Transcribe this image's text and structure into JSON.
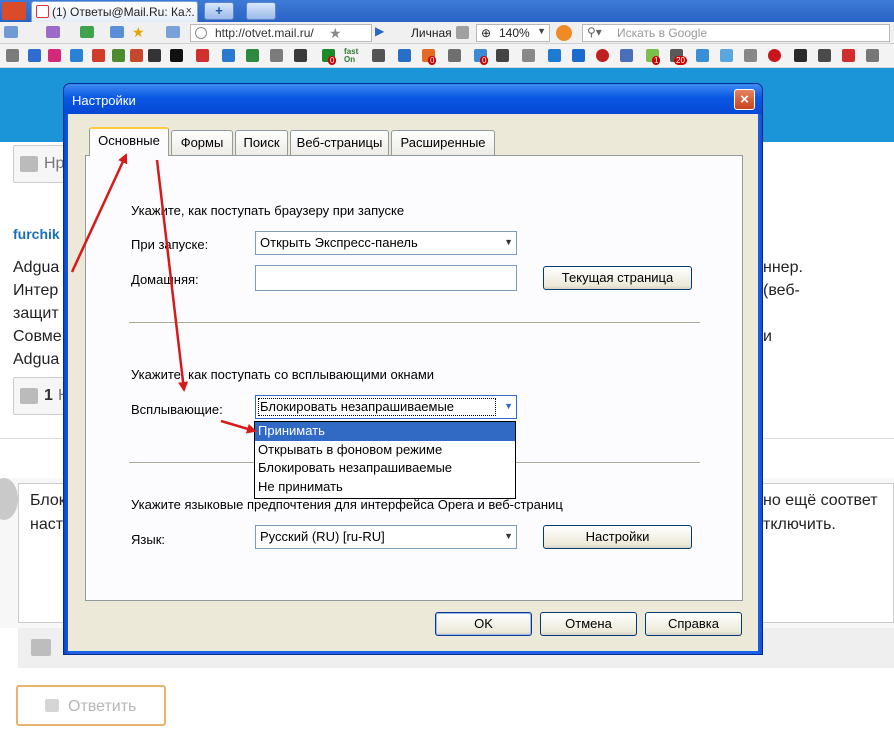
{
  "browser": {
    "tab_title": "(1) Ответы@Mail.Ru: Ка...",
    "tab_close": "×",
    "new_tab": "+",
    "url": "http://otvet.mail.ru/",
    "profile": "Личная",
    "zoom": "140%",
    "search_placeholder": "Искать в Google",
    "badges": [
      "0",
      "0",
      "0",
      "1",
      "20"
    ],
    "fast_on": "fast On"
  },
  "page": {
    "like_top": "Нр",
    "author": "furchik",
    "lines_left": [
      "Adgua",
      "Интер",
      "защит",
      "Совме",
      "Adgua"
    ],
    "lines_right": [
      "ннер.",
      "(веб-",
      "и"
    ],
    "like_count": "1",
    "like_suffix": "Н",
    "answer_left": [
      "Блок",
      "наст"
    ],
    "answer_right": [
      "но ещё соответ",
      "тключить."
    ],
    "reply_button": "Ответить"
  },
  "dialog": {
    "title": "Настройки",
    "close": "×",
    "tabs": [
      "Основные",
      "Формы",
      "Поиск",
      "Веб-страницы",
      "Расширенные"
    ],
    "startup_heading": "Укажите, как поступать браузеру при запуске",
    "startup_label": "При запуске:",
    "startup_value": "Открыть Экспресс-панель",
    "home_label": "Домашняя:",
    "home_value": "",
    "current_page_button": "Текущая страница",
    "popups_heading": "Укажите, как поступать со всплывающими окнами",
    "popups_label": "Всплывающие:",
    "popups_value": "Блокировать незапрашиваемые",
    "popup_options": [
      "Принимать",
      "Открывать в фоновом режиме",
      "Блокировать незапрашиваемые",
      "Не принимать"
    ],
    "popup_selected_index": 0,
    "language_heading": "Укажите языковые предпочтения для интерфейса Opera и веб-страниц",
    "language_label": "Язык:",
    "language_value": "Русский (RU) [ru-RU]",
    "language_settings_button": "Настройки",
    "ok_button": "OK",
    "cancel_button": "Отмена",
    "help_button": "Справка"
  },
  "colors": {
    "page_header": "#1b94d8",
    "dialog_frame": "#1c61e8",
    "selection": "#316ac5",
    "annotation_arrow": "#d61a1a"
  }
}
